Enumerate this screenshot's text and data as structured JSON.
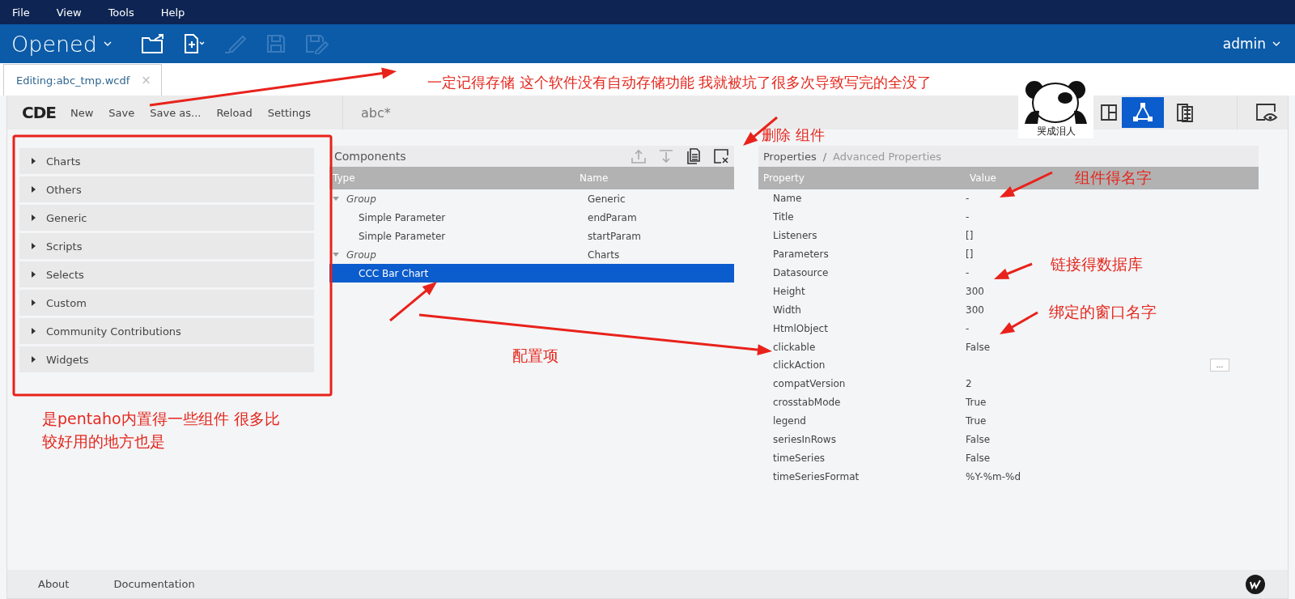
{
  "menu_bar": [
    "File",
    "View",
    "Tools",
    "Help"
  ],
  "header": {
    "title": "Opened",
    "user": "admin"
  },
  "tabs": [
    {
      "label": "Editing:abc_tmp.wcdf",
      "close": "×",
      "selected": true
    }
  ],
  "toolbar": {
    "logo": "CDE",
    "actions": [
      "New",
      "Save",
      "Save as...",
      "Reload",
      "Settings"
    ],
    "dashboard_title": "abc*",
    "views": [
      {
        "kind": "layout",
        "selected": false
      },
      {
        "kind": "components",
        "selected": true
      },
      {
        "kind": "datasources",
        "selected": false
      },
      {
        "kind": "preview",
        "selected": false
      }
    ]
  },
  "palette": [
    {
      "label": "Charts",
      "expanded": false
    },
    {
      "label": "Others",
      "expanded": false
    },
    {
      "label": "Generic",
      "expanded": false
    },
    {
      "label": "Scripts",
      "expanded": false
    },
    {
      "label": "Selects",
      "expanded": false
    },
    {
      "label": "Custom",
      "expanded": false
    },
    {
      "label": "Community Contributions",
      "expanded": false
    },
    {
      "label": "Widgets",
      "expanded": false
    }
  ],
  "components": {
    "title": "Components",
    "columns": [
      "Type",
      "Name"
    ],
    "rows": [
      {
        "type": "Group",
        "name": "Generic",
        "expanded": true,
        "selected": false,
        "children": [
          {
            "type": "Simple Parameter",
            "name": "endParam",
            "selected": false
          },
          {
            "type": "Simple Parameter",
            "name": "startParam",
            "selected": false
          }
        ]
      },
      {
        "type": "Group",
        "name": "Charts",
        "expanded": true,
        "selected": false,
        "children": [
          {
            "type": "CCC Bar Chart",
            "selected": true
          }
        ]
      }
    ]
  },
  "properties": {
    "tabs": [
      {
        "label": "Properties",
        "selected": true
      },
      {
        "label": "Advanced Properties",
        "selected": false
      }
    ],
    "separator": "/",
    "columns": [
      "Property",
      "Value"
    ],
    "rows": [
      {
        "property": "Name",
        "value": "-"
      },
      {
        "property": "Title",
        "value": "-"
      },
      {
        "property": "Listeners",
        "value": "[]"
      },
      {
        "property": "Parameters",
        "value": "[]"
      },
      {
        "property": "Datasource",
        "value": "-"
      },
      {
        "property": "Height",
        "value": "300"
      },
      {
        "property": "Width",
        "value": "300"
      },
      {
        "property": "HtmlObject",
        "value": "-"
      },
      {
        "property": "clickable",
        "value": "False"
      },
      {
        "property": "clickAction",
        "action": "..."
      },
      {
        "property": "compatVersion",
        "value": "2"
      },
      {
        "property": "crosstabMode",
        "value": "True"
      },
      {
        "property": "legend",
        "value": "True"
      },
      {
        "property": "seriesInRows",
        "value": "False"
      },
      {
        "property": "timeSeries",
        "value": "False"
      },
      {
        "property": "timeSeriesFormat",
        "value": "%Y-%m-%d"
      }
    ]
  },
  "footer": [
    "About",
    "Documentation"
  ],
  "annotations": {
    "notes": [
      "一定记得存储  这个软件没有自动存储功能 我就被坑了很多次导致写完的全没了",
      "删除 组件",
      "组件得名字",
      "链接得数据库",
      "绑定的窗口名字",
      "配置项",
      "是pentaho内置得一些组件 很多比较好用的地方也是"
    ],
    "sticker": {
      "caption": "哭成泪人"
    }
  }
}
